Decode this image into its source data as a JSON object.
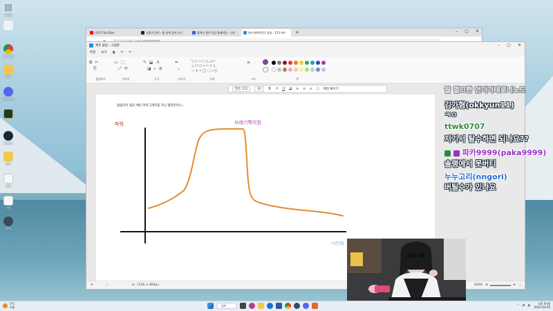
{
  "browser": {
    "tabs": [
      {
        "label": "(415) YouTube",
        "color": "#ff0000"
      },
      {
        "label": "고통이 없어 - 올 한계 없어 유니",
        "color": "#222222"
      },
      {
        "label": "혈액은 붕어 (팀) 황제미팅 - 나만",
        "color": "#3b5bdb"
      },
      {
        "label": "위드파에이전트 방송 - 153 위드",
        "color": "#2d8fd5"
      }
    ],
    "new_tab": "+",
    "url": "inven.co.kr/board/lol/2778/77571"
  },
  "paint": {
    "title": "제목 없음 - 그림판",
    "menu": [
      "파일",
      "보기"
    ],
    "groups": {
      "clipboard": "클립보드",
      "image": "이미지",
      "tools": "도구",
      "brushes": "브러시",
      "shapes": "도형",
      "size": "크기",
      "colors": "색"
    },
    "palette": [
      "#000000",
      "#7f7f7f",
      "#8b1a1a",
      "#e33b2e",
      "#f47c20",
      "#f4d21f",
      "#3aa84b",
      "#1f9bd6",
      "#3347a6",
      "#a63ca3",
      "#ffffff",
      "#c3c3c3",
      "#b97a57",
      "#f6a3c3",
      "#fccb7c",
      "#f4ee9e",
      "#b5e25b",
      "#9bd9ea",
      "#7092be",
      "#c8bfe7"
    ],
    "text_toolbar": {
      "font": "맑은 고딕",
      "size": "10",
      "fill_label": "배경 채우기"
    },
    "status": {
      "canvas_size": "1536 × 864px",
      "zoom": "100%"
    }
  },
  "canvas": {
    "note": "범블이라 평균 애런 파워그래프를 지닌 챔피언이니...",
    "power_label": "파워",
    "peak_label": "쓰레기특이점",
    "corner_mark": "시간/팀",
    "curve_color": "#e88a2d"
  },
  "chat": [
    {
      "text": "잘 껄끄한 언더가테로니노드",
      "color": "#ffffff"
    },
    {
      "text": "김가혐(okkyun11)",
      "color": "#ffffff"
    },
    {
      "text": "ㅋㅇ",
      "color": "#ffffff"
    },
    {
      "text": "ttwk0707",
      "color": "#2e8b3d"
    },
    {
      "text": "저기서 탈수하면 되나요??",
      "color": "#ffffff"
    },
    {
      "text": "파카9999(paka9999)",
      "color": "#9b30c8"
    },
    {
      "text": "솔랭에서 못버티",
      "color": "#ffffff"
    },
    {
      "text": "누누고리(nngori)",
      "color": "#1f6fd0"
    },
    {
      "text": "버틸수가 있나요",
      "color": "#ffffff"
    }
  ],
  "taskbar": {
    "temp": "3°C",
    "weather": "흐림",
    "search": "검색",
    "time": "오후 9:40",
    "date": "2023-03-05"
  },
  "desktop_icons": [
    "휴지통",
    "Chrome",
    "폴더",
    "Discord",
    "Steam",
    "폴더",
    "파일",
    "파일",
    "OBS"
  ]
}
